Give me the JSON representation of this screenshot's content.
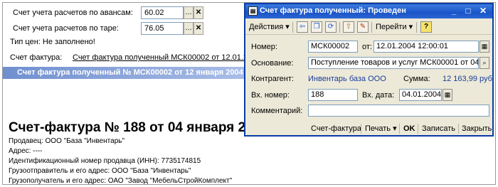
{
  "background": {
    "advance_account_label": "Счет учета расчетов по авансам:",
    "advance_account_value": "60.02",
    "container_account_label": "Счет учета расчетов по таре:",
    "container_account_value": "76.05",
    "price_type_text": "Тип цен: Не заполнено!",
    "invoice_label": "Счет фактура:",
    "invoice_link": "Счет фактура полученный МСК00002 от 12.01.2004",
    "selected_row": "Счет фактура полученный № МСК00002 от 12 января 2004",
    "doc_title": "Счет-фактура № 188 от 04 января 200",
    "lines": [
      "Продавец:  ООО \"База \"Инвентарь\"",
      "Адрес: ----",
      "Идентификационный номер продавца (ИНН): 7735174815",
      "Грузоотправитель и его адрес: ООО \"База \"Инвентарь\"",
      "Грузополучатель и его адрес: ОАО \"Завод \"МебельСтройКомплект\""
    ]
  },
  "dialog": {
    "title": "Счет фактура полученный: Проведен",
    "toolbar": {
      "actions": "Действия",
      "goto": "Перейти"
    },
    "number_label": "Номер:",
    "number_value": "МСК00002",
    "date_from_label": "от:",
    "date_value": "12.01.2004 12:00:01",
    "basis_label": "Основание:",
    "basis_value": "Поступление товаров и услуг МСК00001 от 04.0",
    "contractor_label": "Контрагент:",
    "contractor_value": "Инвентарь база ООО",
    "sum_label": "Сумма:",
    "sum_value": "12 163,99 руб.",
    "in_number_label": "Вх. номер:",
    "in_number_value": "188",
    "in_date_label": "Вх. дата:",
    "in_date_value": "04.01.2004",
    "comment_label": "Комментарий:",
    "comment_value": "",
    "buttons": {
      "invoice": "Счет-фактура",
      "print": "Печать",
      "ok": "OK",
      "save": "Записать",
      "close": "Закрыть"
    }
  },
  "colors": {
    "titlebar": "#1a55c8",
    "dialog_bg": "#ece9d8",
    "selection": "#6f8fcf",
    "link_blue": "#1a3d9a"
  },
  "icons": [
    "ellipsis-icon",
    "clear-x-icon",
    "document-icon",
    "arrow-left-icon",
    "copy-icon",
    "refresh-icon",
    "post-icon",
    "unpost-icon",
    "help-icon",
    "calendar-icon",
    "search-icon"
  ]
}
